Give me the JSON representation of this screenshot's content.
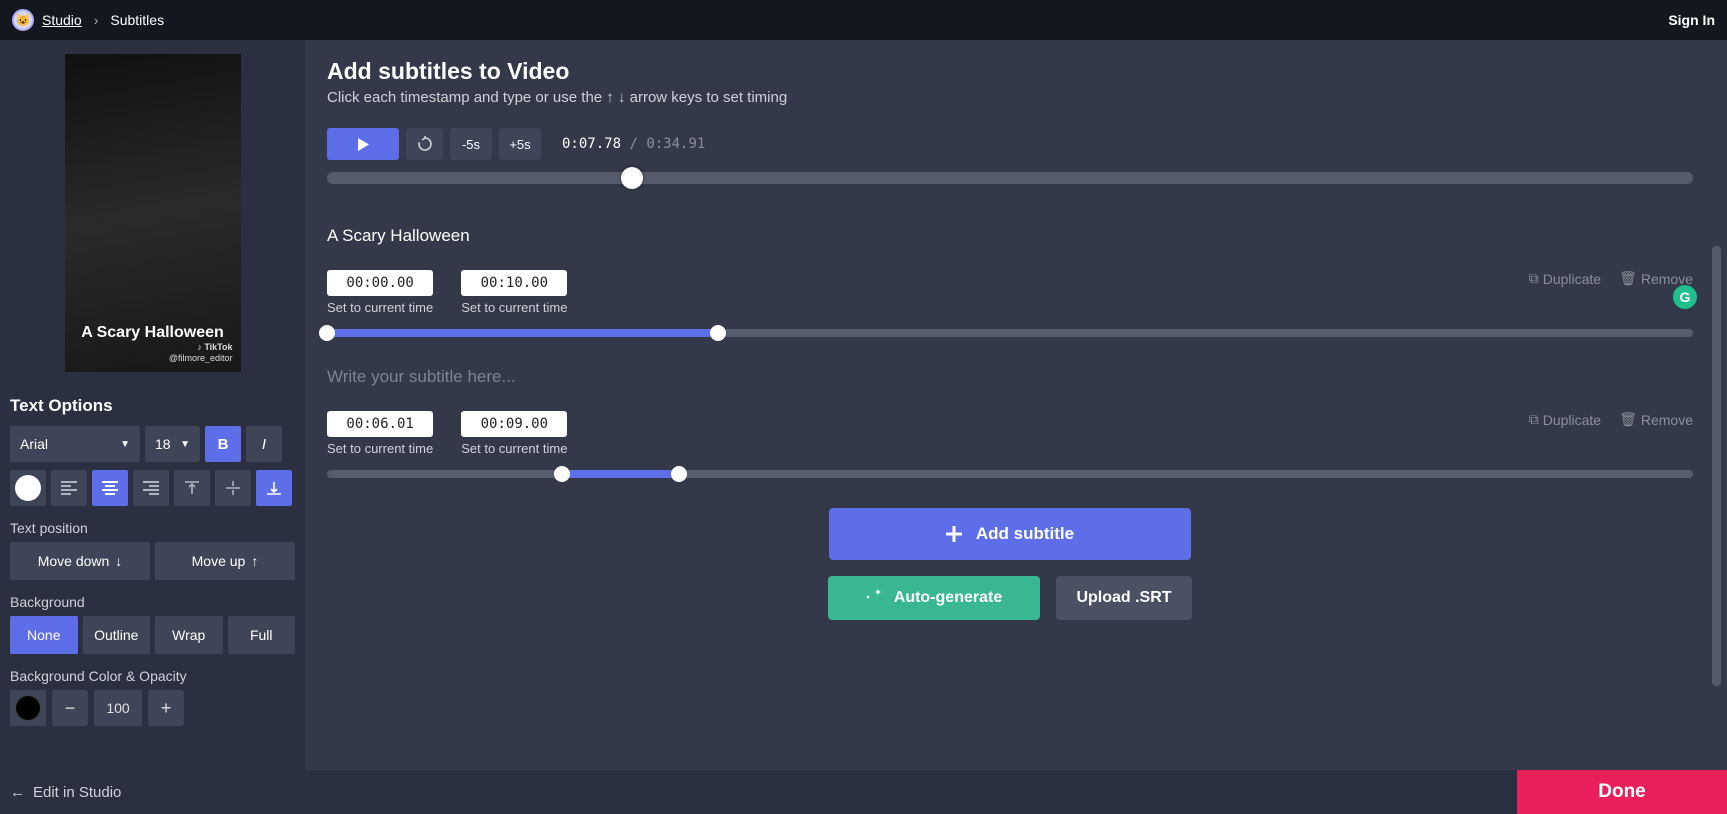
{
  "header": {
    "crumb_root": "Studio",
    "crumb_sep": "›",
    "crumb_leaf": "Subtitles",
    "sign_in": "Sign In"
  },
  "preview": {
    "caption": "A Scary Halloween",
    "brand": "TikTok",
    "handle": "@filmore_editor"
  },
  "text_options": {
    "heading": "Text Options",
    "font": "Arial",
    "size": "18",
    "position_label": "Text position",
    "move_down": "Move down",
    "move_up": "Move up",
    "background_label": "Background",
    "bg_none": "None",
    "bg_outline": "Outline",
    "bg_wrap": "Wrap",
    "bg_full": "Full",
    "bg_color_label": "Background Color & Opacity",
    "opacity": "100"
  },
  "main": {
    "title": "Add subtitles to Video",
    "subtitle": "Click each timestamp and type or use the ↑ ↓ arrow keys to set timing",
    "back5": "-5s",
    "fwd5": "+5s",
    "time_current": "0:07.78",
    "time_sep": "/",
    "time_total": "0:34.91",
    "scrubber_pct": 22.3
  },
  "subs": [
    {
      "text": "A Scary Halloween",
      "placeholder": "",
      "start": "00:00.00",
      "end": "00:10.00",
      "start_pct": 0,
      "end_pct": 28.6,
      "hint": "Set to current time",
      "duplicate": "Duplicate",
      "remove": "Remove"
    },
    {
      "text": "",
      "placeholder": "Write your subtitle here...",
      "start": "00:06.01",
      "end": "00:09.00",
      "start_pct": 17.2,
      "end_pct": 25.8,
      "hint": "Set to current time",
      "duplicate": "Duplicate",
      "remove": "Remove"
    }
  ],
  "actions": {
    "add": "Add subtitle",
    "auto": "Auto-generate",
    "upload": "Upload .SRT"
  },
  "footer": {
    "edit": "Edit in Studio",
    "done": "Done"
  }
}
